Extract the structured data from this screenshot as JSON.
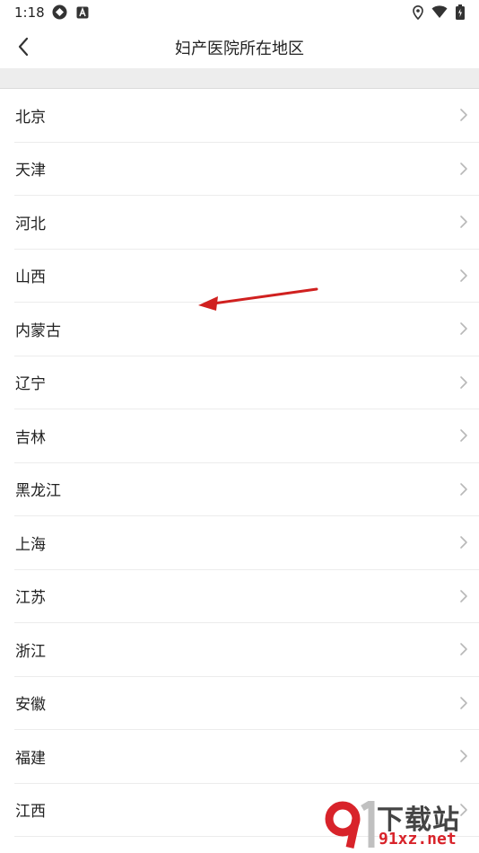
{
  "status_bar": {
    "time": "1:18",
    "left_icons": [
      "sync-icon",
      "a-icon"
    ],
    "right_icons": [
      "location-icon",
      "wifi-icon",
      "battery-icon"
    ]
  },
  "header": {
    "title": "妇产医院所在地区",
    "back_icon": "chevron-left-icon"
  },
  "regions": [
    "北京",
    "天津",
    "河北",
    "山西",
    "内蒙古",
    "辽宁",
    "吉林",
    "黑龙江",
    "上海",
    "江苏",
    "浙江",
    "安徽",
    "福建",
    "江西"
  ],
  "annotation": {
    "arrow_color": "#d0201f"
  },
  "watermark": {
    "logo": "9",
    "top_text": "下载站",
    "bottom_text": "91xz.net"
  }
}
